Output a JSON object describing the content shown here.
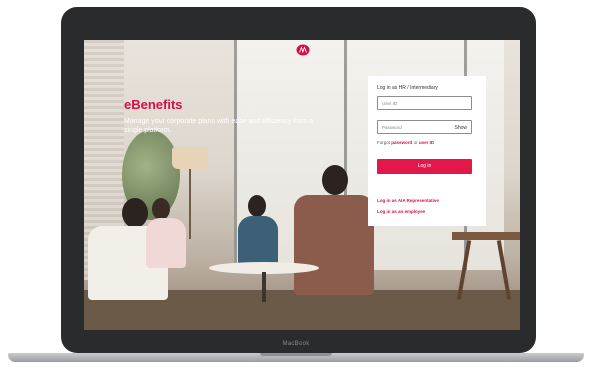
{
  "device": {
    "brand_label": "MacBook"
  },
  "header": {
    "logo_icon": "aia-logo-icon"
  },
  "hero": {
    "title": "eBenefits",
    "subtitle": "Manage your corporate plans with ease and efficiency from a single platform."
  },
  "login": {
    "heading": "Log in as HR / Intermediary",
    "user_id_placeholder": "User ID",
    "password_placeholder": "Password",
    "show_label": "Show",
    "forgot_prefix": "Forgot",
    "forgot_password": "password",
    "forgot_or": "or",
    "forgot_user_id": "user ID",
    "login_button": "Log in",
    "link_aia_rep": "Log in as AIA Representative",
    "link_employee": "Log in as an employee"
  },
  "colors": {
    "brand_red": "#d31145",
    "button_red": "#e4174b"
  }
}
